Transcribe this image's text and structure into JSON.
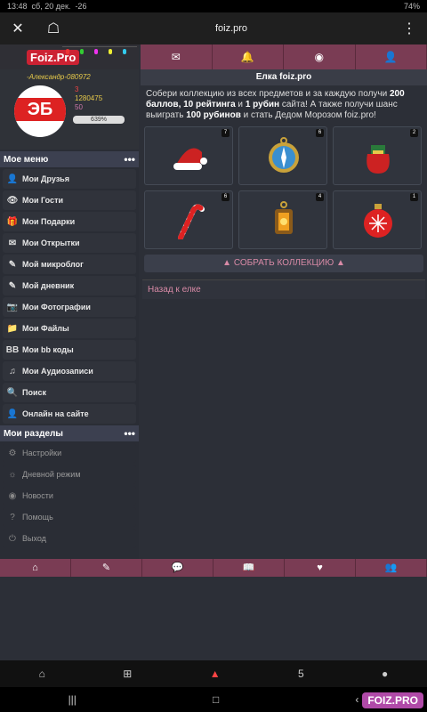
{
  "status": {
    "time": "13:48",
    "date": "сб, 20 дек.",
    "temp": "-26",
    "battery": "74%"
  },
  "browser": {
    "url": "foiz.pro",
    "close": "✕",
    "bookmark": "☖",
    "more": "⋮"
  },
  "logo": {
    "text": "Foiz.Pro"
  },
  "profile": {
    "username": "-Александр-080972",
    "gifts": "3",
    "points": "1280475",
    "rating": "50",
    "progress": "639%"
  },
  "menu": {
    "title": "Мое меню",
    "dots": "•••",
    "items": [
      {
        "label": "Мои Друзья",
        "icon": "👤"
      },
      {
        "label": "Мои Гости",
        "icon": "👁"
      },
      {
        "label": "Мои Подарки",
        "icon": "🎁"
      },
      {
        "label": "Мои Открытки",
        "icon": "✉"
      },
      {
        "label": "Мой микроблог",
        "icon": "✎"
      },
      {
        "label": "Мой дневник",
        "icon": "✎"
      },
      {
        "label": "Мои Фотографии",
        "icon": "📷"
      },
      {
        "label": "Мои Файлы",
        "icon": "📁"
      },
      {
        "label": "Мои bb коды",
        "icon": "BB"
      },
      {
        "label": "Мои Аудиозаписи",
        "icon": "♫"
      },
      {
        "label": "Поиск",
        "icon": "🔍"
      },
      {
        "label": "Онлайн на сайте",
        "icon": "👤"
      }
    ]
  },
  "sections": {
    "title": "Мои разделы",
    "dots": "•••",
    "items": [
      {
        "label": "Настройки",
        "icon": "⚙"
      },
      {
        "label": "Дневной режим",
        "icon": "☼"
      },
      {
        "label": "Новости",
        "icon": "◉"
      },
      {
        "label": "Помощь",
        "icon": "?"
      },
      {
        "label": "Выход",
        "icon": "⏻"
      }
    ]
  },
  "topnav": {
    "mail": "✉",
    "bell": "🔔",
    "rss": "◉",
    "user": "👤"
  },
  "page": {
    "title": "Елка foiz.pro",
    "desc_1": "Собери коллекцию из всех предметов и за каждую получи ",
    "b1": "200 баллов, 10 рейтинга",
    "desc_2": " и ",
    "b2": "1 рубин",
    "desc_3": " сайта! А также получи шанс выиграть ",
    "b3": "100 рубинов",
    "desc_4": " и стать Дедом Морозом foiz.pro!",
    "items": [
      {
        "name": "hat",
        "count": "7"
      },
      {
        "name": "compass",
        "count": "6"
      },
      {
        "name": "sack",
        "count": "2"
      },
      {
        "name": "candy-cane",
        "count": "6"
      },
      {
        "name": "lantern",
        "count": "4"
      },
      {
        "name": "ornament",
        "count": "1"
      }
    ],
    "collect_label": "СОБРАТЬ КОЛЛЕКЦИЮ",
    "collect_arrow": "▲",
    "back_label": "Назад к елке"
  },
  "bottomnav": [
    "⌂",
    "✎",
    "💬",
    "📖",
    "♥",
    "👥"
  ],
  "android": {
    "home": "⌂",
    "apps": "⊞",
    "alice": "▲",
    "tabs": "5",
    "avatar": "●",
    "recent": "|||",
    "center": "□",
    "back": "‹"
  },
  "watermark": "FOIZ.PRO"
}
